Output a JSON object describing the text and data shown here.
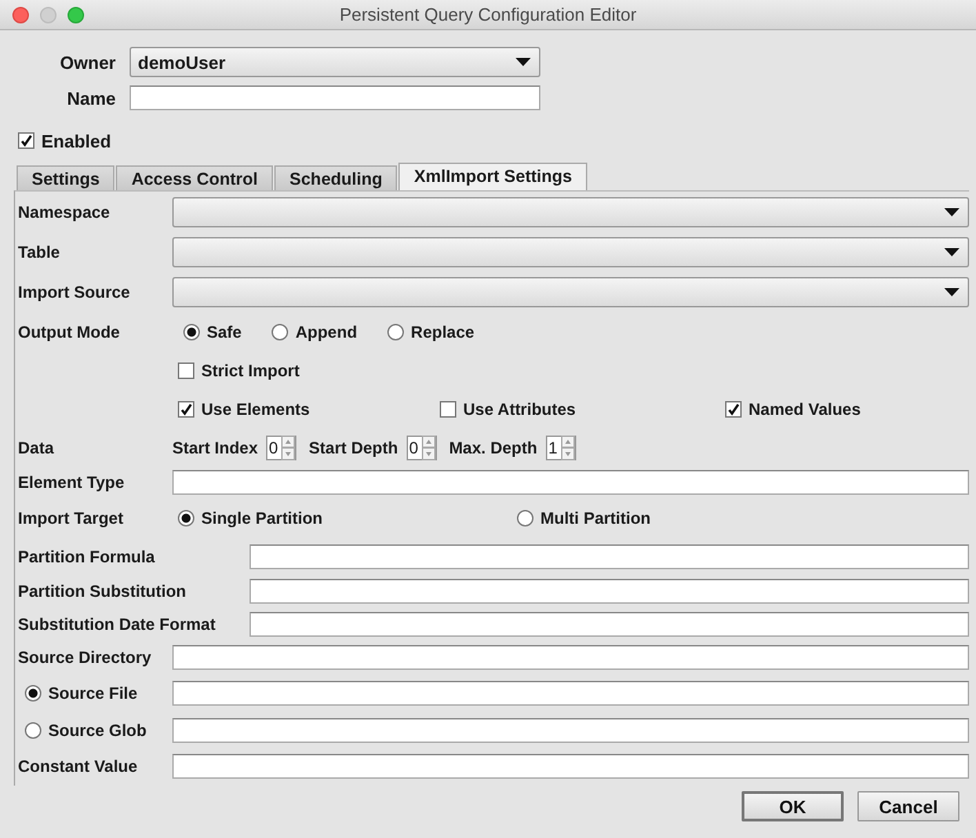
{
  "window": {
    "title": "Persistent Query Configuration Editor"
  },
  "owner": {
    "label": "Owner",
    "value": "demoUser"
  },
  "name": {
    "label": "Name"
  },
  "enabled": {
    "label": "Enabled",
    "checked": true
  },
  "tabs": [
    {
      "label": "Settings",
      "selected": false
    },
    {
      "label": "Access Control",
      "selected": false
    },
    {
      "label": "Scheduling",
      "selected": false
    },
    {
      "label": "XmlImport Settings",
      "selected": true
    }
  ],
  "dropdowns": [
    {
      "label": "Namespace"
    },
    {
      "label": "Table"
    },
    {
      "label": "Import Source"
    }
  ],
  "output_mode": {
    "label": "Output Mode",
    "options": [
      {
        "label": "Safe",
        "selected": true
      },
      {
        "label": "Append",
        "selected": false
      },
      {
        "label": "Replace",
        "selected": false
      }
    ]
  },
  "strict_import": {
    "label": "Strict Import",
    "checked": false
  },
  "flags": [
    {
      "label": "Use Elements",
      "checked": true
    },
    {
      "label": "Use Attributes",
      "checked": false
    },
    {
      "label": "Named Values",
      "checked": true
    }
  ],
  "data": {
    "label": "Data",
    "spinners": [
      {
        "label": "Start Index",
        "value": "0"
      },
      {
        "label": "Start Depth",
        "value": "0"
      },
      {
        "label": "Max. Depth",
        "value": "1"
      }
    ]
  },
  "element_type": {
    "label": "Element Type"
  },
  "import_target": {
    "label": "Import Target",
    "options": [
      {
        "label": "Single Partition",
        "selected": true
      },
      {
        "label": "Multi Partition",
        "selected": false
      }
    ]
  },
  "partition_fields": [
    {
      "label": "Partition Formula"
    },
    {
      "label": "Partition Substitution"
    },
    {
      "label": "Substitution Date Format"
    }
  ],
  "source_directory": {
    "label": "Source Directory"
  },
  "source_options": [
    {
      "label": "Source File",
      "selected": true
    },
    {
      "label": "Source Glob",
      "selected": false
    }
  ],
  "constant_value": {
    "label": "Constant Value"
  },
  "buttons": [
    {
      "label": "OK",
      "default": true
    },
    {
      "label": "Cancel",
      "default": false
    }
  ]
}
